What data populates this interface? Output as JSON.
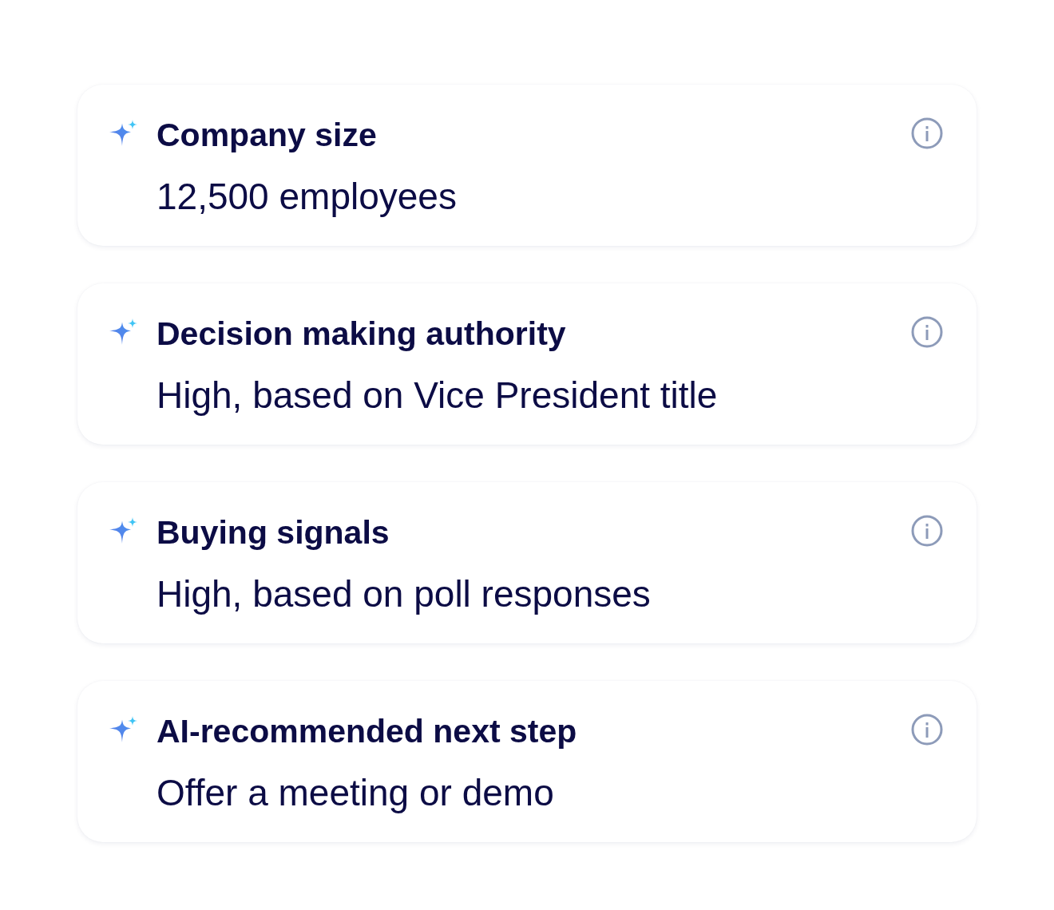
{
  "cards": [
    {
      "title": "Company size",
      "value": "12,500 employees"
    },
    {
      "title": "Decision making authority",
      "value": "High, based on Vice President title"
    },
    {
      "title": "Buying signals",
      "value": "High, based on poll responses"
    },
    {
      "title": "AI-recommended next step",
      "value": "Offer a meeting or demo"
    }
  ]
}
